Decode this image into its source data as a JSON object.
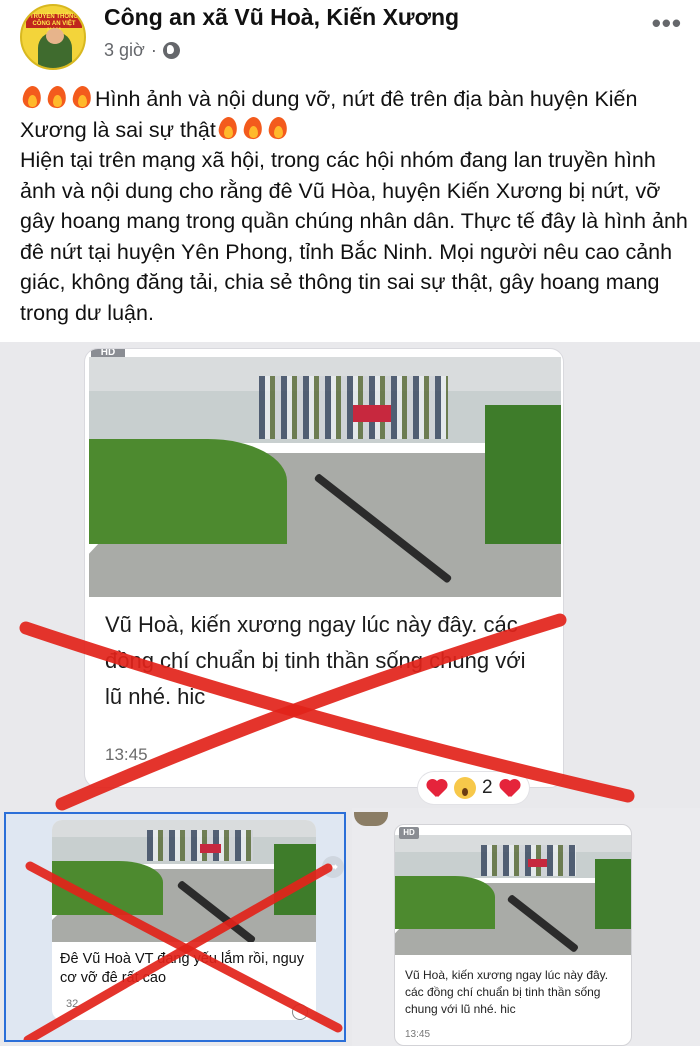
{
  "post": {
    "author": "Công an xã Vũ Hoà, Kiến Xương",
    "time": "3 giờ",
    "separator": "·",
    "more": "•••",
    "headline": "Hình ảnh và nội dung vỡ, nứt đê trên địa bàn huyện Kiến Xương là sai sự thật",
    "body": "Hiện tại trên mạng xã hội, trong các hội nhóm đang lan truyền hình ảnh và nội dung cho rằng đê Vũ Hòa, huyện Kiến Xương bị nứt, vỡ gây hoang mang trong quần chúng nhân dân. Thực tế đây là hình ảnh đê nứt tại huyện Yên Phong, tỉnh Bắc Ninh. Mọi người nêu cao cảnh giác, không đăng tải, chia sẻ thông tin sai sự thật, gây hoang mang trong dư luận."
  },
  "avatar_banner": "TRUYỀN THỐNG CÔNG AN VIỆT NAM",
  "main_message": {
    "hd": "HD",
    "text": "Vũ Hoà, kiến xương ngay lúc này đây. các đồng chí chuẩn bị tinh thần sống chung với lũ nhé. hic",
    "time": "13:45",
    "reaction_count": "2"
  },
  "left_message": {
    "text": "Đê Vũ Hoà VT đang yếu lắm rồi, nguy cơ vỡ đê rất cao",
    "time": "32"
  },
  "right_message": {
    "hd": "HD",
    "text": "Vũ Hoà, kiến xương ngay lúc này đây. các đồng chí chuẩn bị tinh thần sống chung với lũ nhé. hic",
    "time": "13:45"
  },
  "colors": {
    "cross": "#e2231a",
    "fire": "#f35b1d",
    "selection_border": "#2b6fd8"
  },
  "icons": [
    "fire-icon",
    "globe-icon",
    "more-icon",
    "heart-icon",
    "wow-icon",
    "share-icon",
    "cross-mark"
  ]
}
